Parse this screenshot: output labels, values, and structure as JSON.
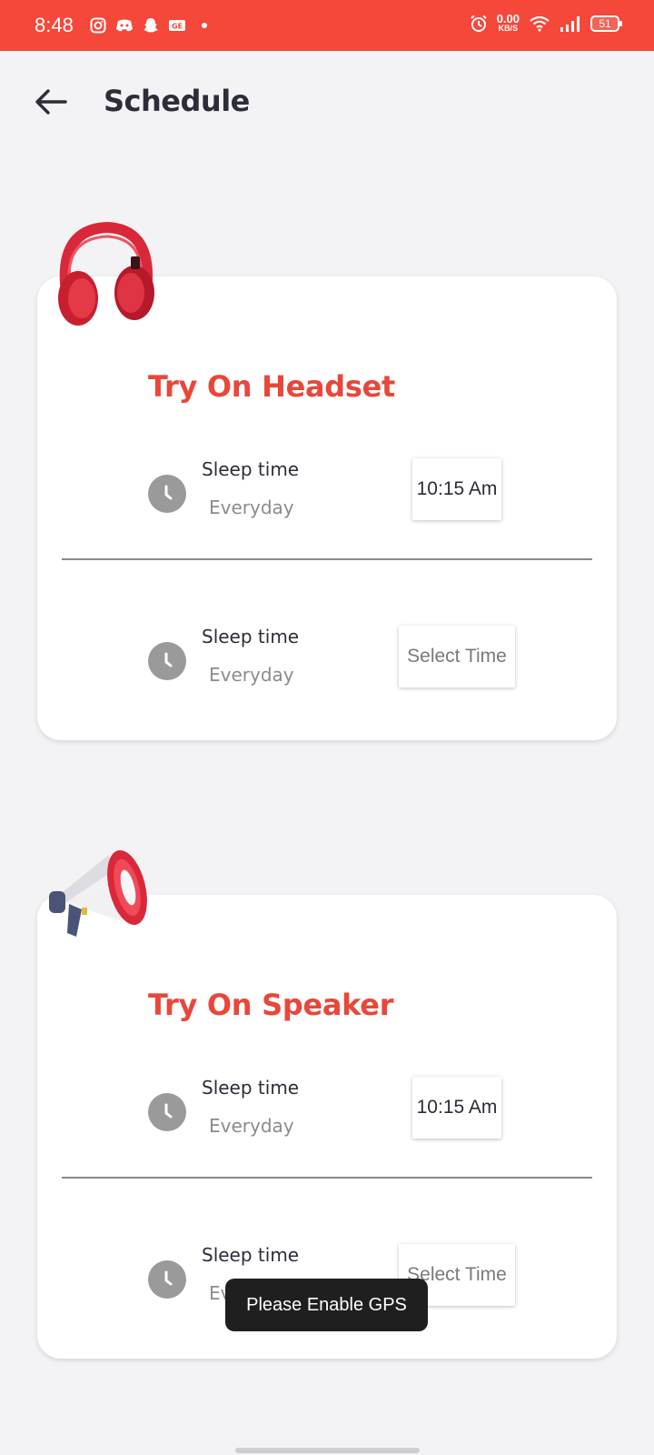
{
  "status_bar": {
    "time": "8:48",
    "speed_value": "0.00",
    "speed_unit": "KB/S",
    "battery": "51",
    "left_icons": [
      "instagram-icon",
      "discord-icon",
      "snapchat-icon",
      "gallery-icon"
    ],
    "right_icons": [
      "alarm-icon",
      "wifi-icon",
      "signal-icon",
      "battery-icon"
    ],
    "color": "#f5473a"
  },
  "header": {
    "title": "Schedule"
  },
  "cards": [
    {
      "title": "Try On Headset",
      "illustration": "headphones",
      "rows": [
        {
          "label": "Sleep time",
          "sub": "Everyday",
          "time": "10:15 Am"
        },
        {
          "label": "Sleep time",
          "sub": "Everyday",
          "time": "Select Time"
        }
      ]
    },
    {
      "title": "Try On Speaker",
      "illustration": "megaphone",
      "rows": [
        {
          "label": "Sleep time",
          "sub": "Everyday",
          "time": "10:15 Am"
        },
        {
          "label": "Sleep time",
          "sub": "Everyday",
          "time": "Select Time"
        }
      ]
    }
  ],
  "toast": "Please Enable GPS",
  "colors": {
    "accent": "#e8473a",
    "background": "#f3f3f5",
    "clock": "#9a9a9a"
  }
}
